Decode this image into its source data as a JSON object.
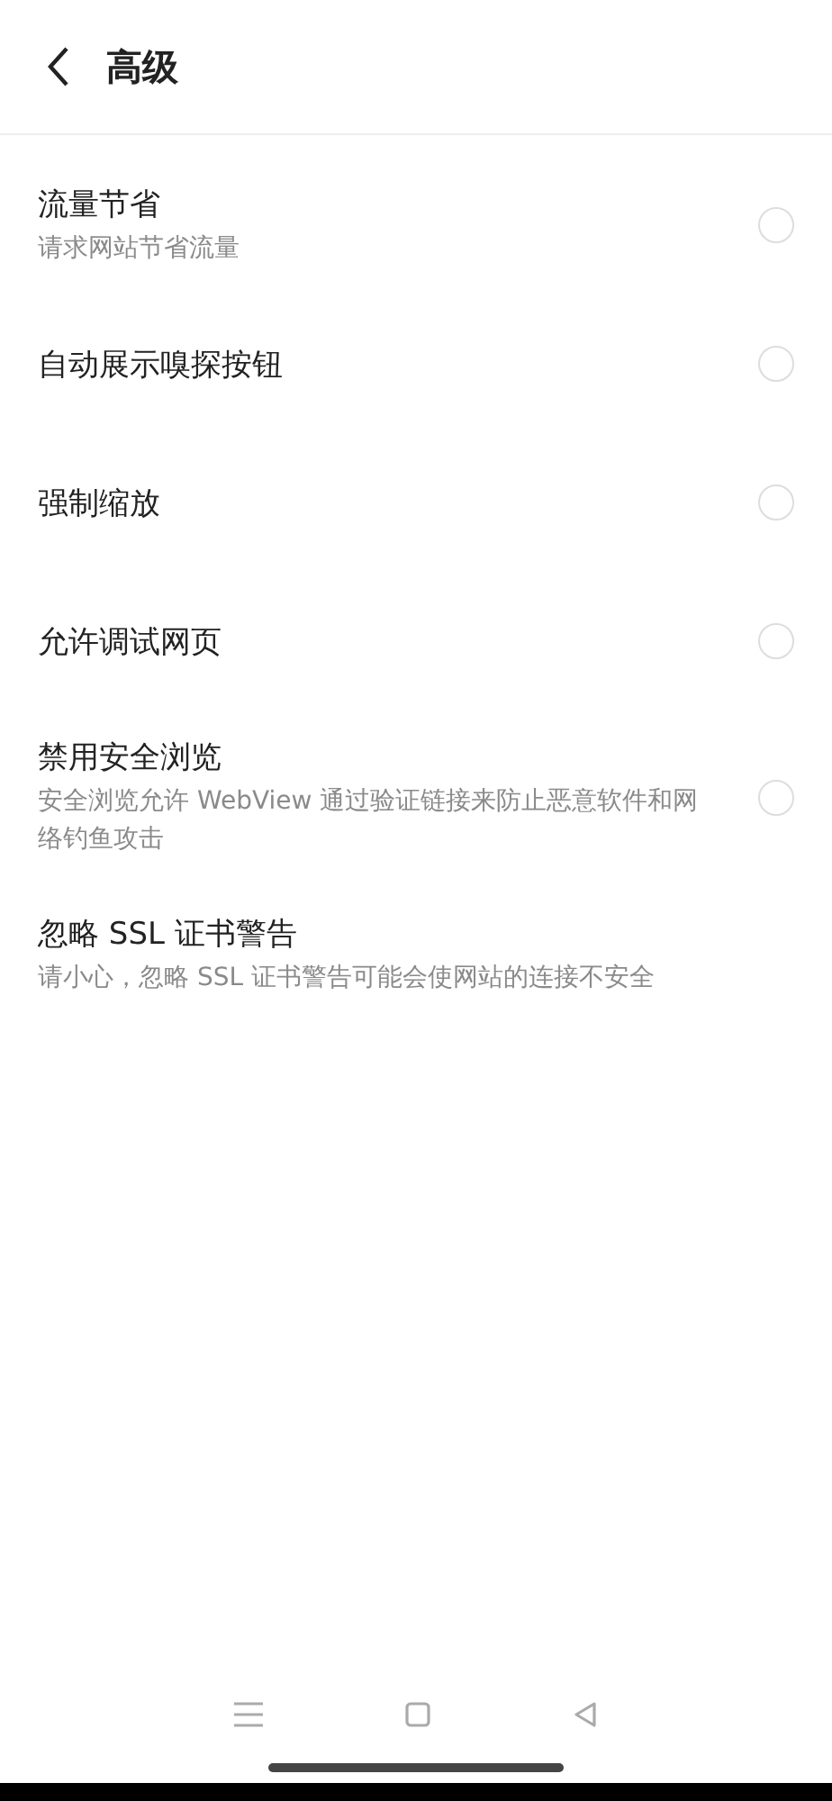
{
  "header": {
    "title": "高级"
  },
  "settings": [
    {
      "kind": "radio",
      "title": "流量节省",
      "subtitle": "请求网站节省流量",
      "checked": false
    },
    {
      "kind": "radio",
      "title": "自动展示嗅探按钮",
      "checked": false
    },
    {
      "kind": "radio",
      "title": "强制缩放",
      "checked": false
    },
    {
      "kind": "radio",
      "title": "允许调试网页",
      "checked": false
    },
    {
      "kind": "radio",
      "title": "禁用安全浏览",
      "subtitle": "安全浏览允许 WebView 通过验证链接来防止恶意软件和网络钓鱼攻击",
      "checked": false
    },
    {
      "kind": "plain",
      "title": "忽略 SSL 证书警告",
      "subtitle": "请小心，忽略 SSL 证书警告可能会使网站的连接不安全"
    }
  ]
}
